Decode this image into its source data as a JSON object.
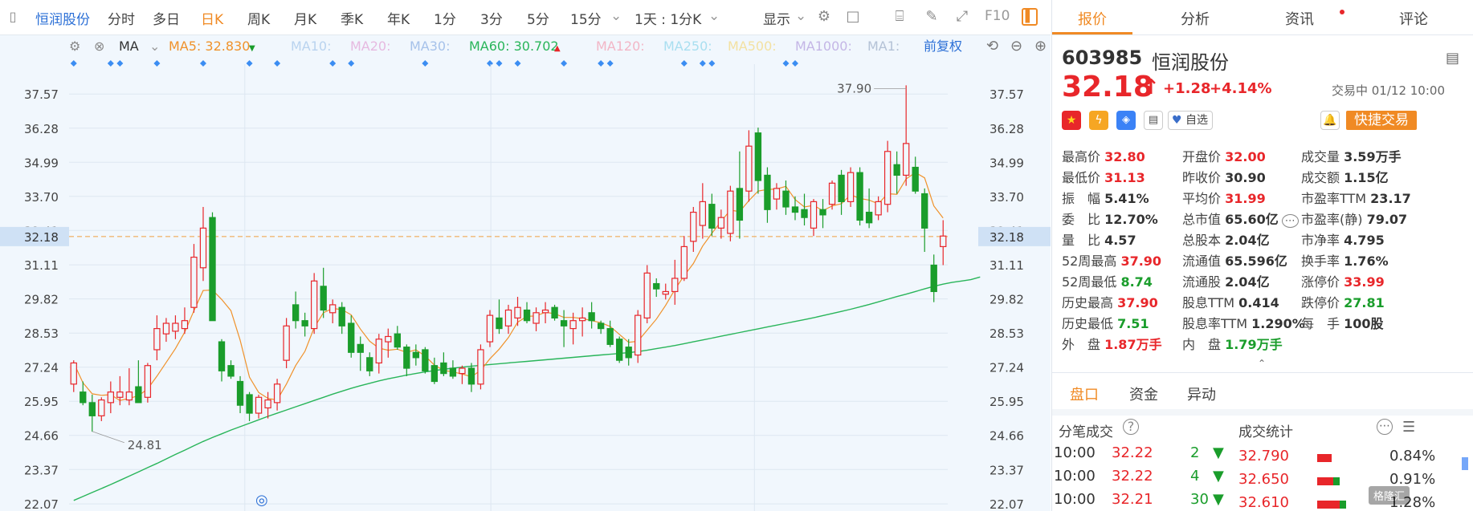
{
  "colors": {
    "up": "#e8262a",
    "down": "#1a9d2b",
    "accent": "#f08a24",
    "ma5": "#f0922b",
    "ma60": "#29b55a",
    "blue": "#2b6fd6"
  },
  "toolbar": {
    "stock_name": "恒润股份",
    "periods": [
      "分时",
      "多日",
      "日K",
      "周K",
      "月K",
      "季K",
      "年K",
      "1分",
      "3分",
      "5分",
      "15分"
    ],
    "active_period": "日K",
    "interval": "1天 : 1分K",
    "display": "显示",
    "f10": "F10"
  },
  "indicator_bar": {
    "ma_label": "MA",
    "ma5": "MA5: 32.830",
    "ma10": "MA10:",
    "ma20": "MA20:",
    "ma30": "MA30:",
    "ma60": "MA60: 30.702",
    "ma120": "MA120:",
    "ma250": "MA250:",
    "ma500": "MA500:",
    "ma1000": "MA1000:",
    "ma1": "MA1:",
    "adjust": "前复权"
  },
  "chart_data": {
    "type": "candlestick",
    "ylim": [
      21.8,
      38.7
    ],
    "yticks": [
      "37.57",
      "36.28",
      "34.99",
      "33.70",
      "32.41",
      "31.11",
      "29.82",
      "28.53",
      "27.24",
      "25.95",
      "24.66",
      "23.37",
      "22.07"
    ],
    "current_price": 32.18,
    "current_price_label": "32.18",
    "annotations": [
      {
        "text": "37.90",
        "value": 37.9
      },
      {
        "text": "24.81",
        "value": 24.81
      }
    ],
    "candles": [
      {
        "o": 26.6,
        "h": 27.5,
        "l": 26.3,
        "c": 27.4
      },
      {
        "o": 26.3,
        "h": 26.7,
        "l": 25.8,
        "c": 25.9
      },
      {
        "o": 25.9,
        "h": 26.2,
        "l": 24.8,
        "c": 25.4
      },
      {
        "o": 25.4,
        "h": 26.1,
        "l": 25.2,
        "c": 26.0
      },
      {
        "o": 25.9,
        "h": 26.7,
        "l": 25.5,
        "c": 26.3
      },
      {
        "o": 26.1,
        "h": 26.9,
        "l": 25.8,
        "c": 26.3
      },
      {
        "o": 26.0,
        "h": 27.2,
        "l": 25.8,
        "c": 26.3
      },
      {
        "o": 26.5,
        "h": 27.5,
        "l": 25.9,
        "c": 25.9
      },
      {
        "o": 26.1,
        "h": 27.4,
        "l": 25.9,
        "c": 27.3
      },
      {
        "o": 27.9,
        "h": 29.2,
        "l": 27.5,
        "c": 28.7
      },
      {
        "o": 28.5,
        "h": 29.1,
        "l": 28.2,
        "c": 28.9
      },
      {
        "o": 28.6,
        "h": 29.2,
        "l": 28.3,
        "c": 28.9
      },
      {
        "o": 28.7,
        "h": 29.5,
        "l": 28.5,
        "c": 29.0
      },
      {
        "o": 29.5,
        "h": 31.9,
        "l": 29.3,
        "c": 31.4
      },
      {
        "o": 31.0,
        "h": 33.3,
        "l": 30.5,
        "c": 32.5
      },
      {
        "o": 32.9,
        "h": 33.1,
        "l": 29.0,
        "c": 29.0
      },
      {
        "o": 28.2,
        "h": 28.3,
        "l": 26.7,
        "c": 27.1
      },
      {
        "o": 27.3,
        "h": 27.5,
        "l": 26.8,
        "c": 26.9
      },
      {
        "o": 26.7,
        "h": 26.9,
        "l": 25.5,
        "c": 25.8
      },
      {
        "o": 26.2,
        "h": 26.3,
        "l": 25.2,
        "c": 25.5
      },
      {
        "o": 25.5,
        "h": 26.2,
        "l": 25.3,
        "c": 26.1
      },
      {
        "o": 25.7,
        "h": 26.3,
        "l": 25.3,
        "c": 26.0
      },
      {
        "o": 25.9,
        "h": 26.8,
        "l": 25.6,
        "c": 26.6
      },
      {
        "o": 27.5,
        "h": 29.1,
        "l": 27.2,
        "c": 28.8
      },
      {
        "o": 29.6,
        "h": 30.1,
        "l": 28.7,
        "c": 29.0
      },
      {
        "o": 29.0,
        "h": 29.3,
        "l": 28.4,
        "c": 28.8
      },
      {
        "o": 28.7,
        "h": 30.8,
        "l": 28.5,
        "c": 30.5
      },
      {
        "o": 30.3,
        "h": 31.0,
        "l": 29.1,
        "c": 29.4
      },
      {
        "o": 29.3,
        "h": 29.8,
        "l": 28.9,
        "c": 29.6
      },
      {
        "o": 29.5,
        "h": 29.7,
        "l": 28.5,
        "c": 28.8
      },
      {
        "o": 28.9,
        "h": 29.2,
        "l": 27.6,
        "c": 27.8
      },
      {
        "o": 28.1,
        "h": 28.4,
        "l": 27.1,
        "c": 27.8
      },
      {
        "o": 27.6,
        "h": 27.8,
        "l": 26.9,
        "c": 27.1
      },
      {
        "o": 27.4,
        "h": 28.5,
        "l": 27.0,
        "c": 28.3
      },
      {
        "o": 28.2,
        "h": 28.7,
        "l": 27.6,
        "c": 28.4
      },
      {
        "o": 28.5,
        "h": 28.8,
        "l": 27.9,
        "c": 28.0
      },
      {
        "o": 28.0,
        "h": 28.1,
        "l": 26.9,
        "c": 27.2
      },
      {
        "o": 27.8,
        "h": 28.1,
        "l": 27.3,
        "c": 27.6
      },
      {
        "o": 27.9,
        "h": 28.0,
        "l": 27.0,
        "c": 27.1
      },
      {
        "o": 27.3,
        "h": 27.6,
        "l": 26.6,
        "c": 26.7
      },
      {
        "o": 27.4,
        "h": 27.8,
        "l": 26.9,
        "c": 27.0
      },
      {
        "o": 27.2,
        "h": 27.5,
        "l": 26.8,
        "c": 26.9
      },
      {
        "o": 27.0,
        "h": 27.3,
        "l": 26.6,
        "c": 27.2
      },
      {
        "o": 27.2,
        "h": 27.4,
        "l": 26.3,
        "c": 26.6
      },
      {
        "o": 26.6,
        "h": 28.1,
        "l": 26.4,
        "c": 27.9
      },
      {
        "o": 28.2,
        "h": 29.4,
        "l": 28.0,
        "c": 29.2
      },
      {
        "o": 29.1,
        "h": 29.8,
        "l": 28.5,
        "c": 28.7
      },
      {
        "o": 28.8,
        "h": 29.6,
        "l": 28.5,
        "c": 29.4
      },
      {
        "o": 29.1,
        "h": 29.9,
        "l": 28.8,
        "c": 29.5
      },
      {
        "o": 29.4,
        "h": 29.7,
        "l": 28.9,
        "c": 29.0
      },
      {
        "o": 28.9,
        "h": 29.5,
        "l": 28.6,
        "c": 29.3
      },
      {
        "o": 29.3,
        "h": 29.7,
        "l": 28.9,
        "c": 29.4
      },
      {
        "o": 29.5,
        "h": 29.6,
        "l": 29.0,
        "c": 29.1
      },
      {
        "o": 29.0,
        "h": 29.4,
        "l": 28.0,
        "c": 28.8
      },
      {
        "o": 28.7,
        "h": 29.3,
        "l": 28.1,
        "c": 29.0
      },
      {
        "o": 29.0,
        "h": 29.5,
        "l": 28.4,
        "c": 29.1
      },
      {
        "o": 29.3,
        "h": 29.7,
        "l": 28.7,
        "c": 29.0
      },
      {
        "o": 28.9,
        "h": 29.0,
        "l": 28.5,
        "c": 28.7
      },
      {
        "o": 28.7,
        "h": 29.0,
        "l": 28.0,
        "c": 28.1
      },
      {
        "o": 28.3,
        "h": 28.4,
        "l": 27.4,
        "c": 27.5
      },
      {
        "o": 28.0,
        "h": 28.3,
        "l": 27.3,
        "c": 27.6
      },
      {
        "o": 27.7,
        "h": 29.4,
        "l": 27.4,
        "c": 29.2
      },
      {
        "o": 29.1,
        "h": 31.1,
        "l": 28.9,
        "c": 30.8
      },
      {
        "o": 30.4,
        "h": 30.6,
        "l": 29.9,
        "c": 30.2
      },
      {
        "o": 30.0,
        "h": 30.4,
        "l": 29.8,
        "c": 30.1
      },
      {
        "o": 30.1,
        "h": 31.3,
        "l": 29.6,
        "c": 30.6
      },
      {
        "o": 30.6,
        "h": 32.2,
        "l": 30.5,
        "c": 31.8
      },
      {
        "o": 32.0,
        "h": 33.3,
        "l": 31.6,
        "c": 33.1
      },
      {
        "o": 32.6,
        "h": 34.2,
        "l": 32.1,
        "c": 33.5
      },
      {
        "o": 33.4,
        "h": 33.8,
        "l": 32.2,
        "c": 32.5
      },
      {
        "o": 32.5,
        "h": 33.2,
        "l": 32.1,
        "c": 32.9
      },
      {
        "o": 32.3,
        "h": 34.1,
        "l": 32.0,
        "c": 33.9
      },
      {
        "o": 34.0,
        "h": 35.4,
        "l": 32.1,
        "c": 32.8
      },
      {
        "o": 33.9,
        "h": 36.2,
        "l": 33.5,
        "c": 35.6
      },
      {
        "o": 36.1,
        "h": 36.3,
        "l": 33.8,
        "c": 34.3
      },
      {
        "o": 34.5,
        "h": 34.8,
        "l": 32.7,
        "c": 33.2
      },
      {
        "o": 33.6,
        "h": 34.2,
        "l": 33.2,
        "c": 34.0
      },
      {
        "o": 33.9,
        "h": 34.3,
        "l": 33.0,
        "c": 33.3
      },
      {
        "o": 33.3,
        "h": 33.7,
        "l": 32.8,
        "c": 33.1
      },
      {
        "o": 33.2,
        "h": 33.8,
        "l": 32.6,
        "c": 32.9
      },
      {
        "o": 32.5,
        "h": 33.6,
        "l": 32.2,
        "c": 33.5
      },
      {
        "o": 33.2,
        "h": 33.6,
        "l": 32.5,
        "c": 33.0
      },
      {
        "o": 33.4,
        "h": 34.3,
        "l": 33.2,
        "c": 34.2
      },
      {
        "o": 34.5,
        "h": 34.7,
        "l": 33.0,
        "c": 33.5
      },
      {
        "o": 33.5,
        "h": 34.8,
        "l": 33.3,
        "c": 34.6
      },
      {
        "o": 34.6,
        "h": 34.8,
        "l": 32.6,
        "c": 32.8
      },
      {
        "o": 33.1,
        "h": 34.0,
        "l": 32.5,
        "c": 32.7
      },
      {
        "o": 33.0,
        "h": 33.7,
        "l": 32.8,
        "c": 33.5
      },
      {
        "o": 33.4,
        "h": 35.8,
        "l": 33.1,
        "c": 35.4
      },
      {
        "o": 34.9,
        "h": 35.4,
        "l": 33.8,
        "c": 34.5
      },
      {
        "o": 34.5,
        "h": 37.9,
        "l": 34.1,
        "c": 35.7
      },
      {
        "o": 34.8,
        "h": 35.2,
        "l": 33.8,
        "c": 33.9
      },
      {
        "o": 33.8,
        "h": 34.0,
        "l": 31.6,
        "c": 32.5
      },
      {
        "o": 31.1,
        "h": 31.5,
        "l": 29.7,
        "c": 30.1
      },
      {
        "o": 31.8,
        "h": 32.8,
        "l": 31.1,
        "c": 32.2
      }
    ],
    "ma60": [
      22.2,
      22.35,
      22.5,
      22.65,
      22.8,
      22.96,
      23.12,
      23.28,
      23.44,
      23.6,
      23.77,
      23.94,
      24.1,
      24.27,
      24.43,
      24.58,
      24.72,
      24.86,
      24.99,
      25.12,
      25.25,
      25.38,
      25.5,
      25.62,
      25.74,
      25.86,
      25.98,
      26.1,
      26.22,
      26.33,
      26.44,
      26.54,
      26.63,
      26.72,
      26.8,
      26.87,
      26.94,
      27.0,
      27.06,
      27.11,
      27.16,
      27.2,
      27.24,
      27.28,
      27.31,
      27.34,
      27.37,
      27.4,
      27.43,
      27.46,
      27.49,
      27.52,
      27.55,
      27.58,
      27.61,
      27.64,
      27.67,
      27.7,
      27.73,
      27.76,
      27.79,
      27.83,
      27.88,
      27.94,
      28.0,
      28.06,
      28.13,
      28.2,
      28.27,
      28.34,
      28.41,
      28.48,
      28.55,
      28.62,
      28.69,
      28.76,
      28.83,
      28.9,
      28.97,
      29.04,
      29.11,
      29.19,
      29.27,
      29.35,
      29.43,
      29.52,
      29.61,
      29.71,
      29.81,
      29.91,
      30.0,
      30.1,
      30.2,
      30.3,
      30.38,
      30.45,
      30.5,
      30.55,
      30.65
    ]
  },
  "quote": {
    "code": "603985",
    "name": "恒润股份",
    "price": "32.18",
    "arrow": "↑",
    "change": "+1.28",
    "change_pct": "+4.14%",
    "status": "交易中 01/12 10:00",
    "watch": "自选",
    "quick_trade": "快捷交易"
  },
  "stats": [
    {
      "label": "最高价",
      "value": "32.80",
      "color": "red"
    },
    {
      "label": "开盘价",
      "value": "32.00",
      "color": "red"
    },
    {
      "label": "成交量",
      "value": "3.59万手",
      "color": ""
    },
    {
      "label": "最低价",
      "value": "31.13",
      "color": "red"
    },
    {
      "label": "昨收价",
      "value": "30.90",
      "color": ""
    },
    {
      "label": "成交额",
      "value": "1.15亿",
      "color": ""
    },
    {
      "label": "振　幅",
      "value": "5.41%",
      "color": ""
    },
    {
      "label": "平均价",
      "value": "31.99",
      "color": "red"
    },
    {
      "label": "市盈率TTM",
      "value": "23.17",
      "color": ""
    },
    {
      "label": "委　比",
      "value": "12.70%",
      "color": ""
    },
    {
      "label": "总市值",
      "value": "65.60亿",
      "color": ""
    },
    {
      "label": "市盈率(静)",
      "value": "79.07",
      "color": ""
    },
    {
      "label": "量　比",
      "value": "4.57",
      "color": ""
    },
    {
      "label": "总股本",
      "value": "2.04亿",
      "color": ""
    },
    {
      "label": "市净率",
      "value": "4.795",
      "color": ""
    },
    {
      "label": "52周最高",
      "value": "37.90",
      "color": "red"
    },
    {
      "label": "流通值",
      "value": "65.596亿",
      "color": ""
    },
    {
      "label": "换手率",
      "value": "1.76%",
      "color": ""
    },
    {
      "label": "52周最低",
      "value": "8.74",
      "color": "green"
    },
    {
      "label": "流通股",
      "value": "2.04亿",
      "color": ""
    },
    {
      "label": "涨停价",
      "value": "33.99",
      "color": "red"
    },
    {
      "label": "历史最高",
      "value": "37.90",
      "color": "red"
    },
    {
      "label": "股息TTM",
      "value": "0.414",
      "color": ""
    },
    {
      "label": "跌停价",
      "value": "27.81",
      "color": "green"
    },
    {
      "label": "历史最低",
      "value": "7.51",
      "color": "green"
    },
    {
      "label": "股息率TTM",
      "value": "1.290%",
      "color": ""
    },
    {
      "label": "每　手",
      "value": "100股",
      "color": ""
    },
    {
      "label": "外　盘",
      "value": "1.87万手",
      "color": "red"
    },
    {
      "label": "内　盘",
      "value": "1.79万手",
      "color": "green"
    }
  ],
  "right_tabs": [
    "报价",
    "分析",
    "资讯",
    "评论"
  ],
  "bottom_tabs": [
    "盘口",
    "资金",
    "异动"
  ],
  "ticks_title": "分笔成交",
  "stats_title": "成交统计",
  "ticks": [
    {
      "time": "10:00",
      "price": "32.22",
      "vol": "2"
    },
    {
      "time": "10:00",
      "price": "32.22",
      "vol": "4"
    },
    {
      "time": "10:00",
      "price": "32.21",
      "vol": "30"
    }
  ],
  "volume_stats": [
    {
      "price": "32.790",
      "pct": "0.84%",
      "share": 0.84
    },
    {
      "price": "32.650",
      "pct": "0.91%",
      "share": 0.91
    },
    {
      "price": "32.610",
      "pct": "1.28%",
      "share": 1.28
    }
  ],
  "watermark": "格隆汇"
}
